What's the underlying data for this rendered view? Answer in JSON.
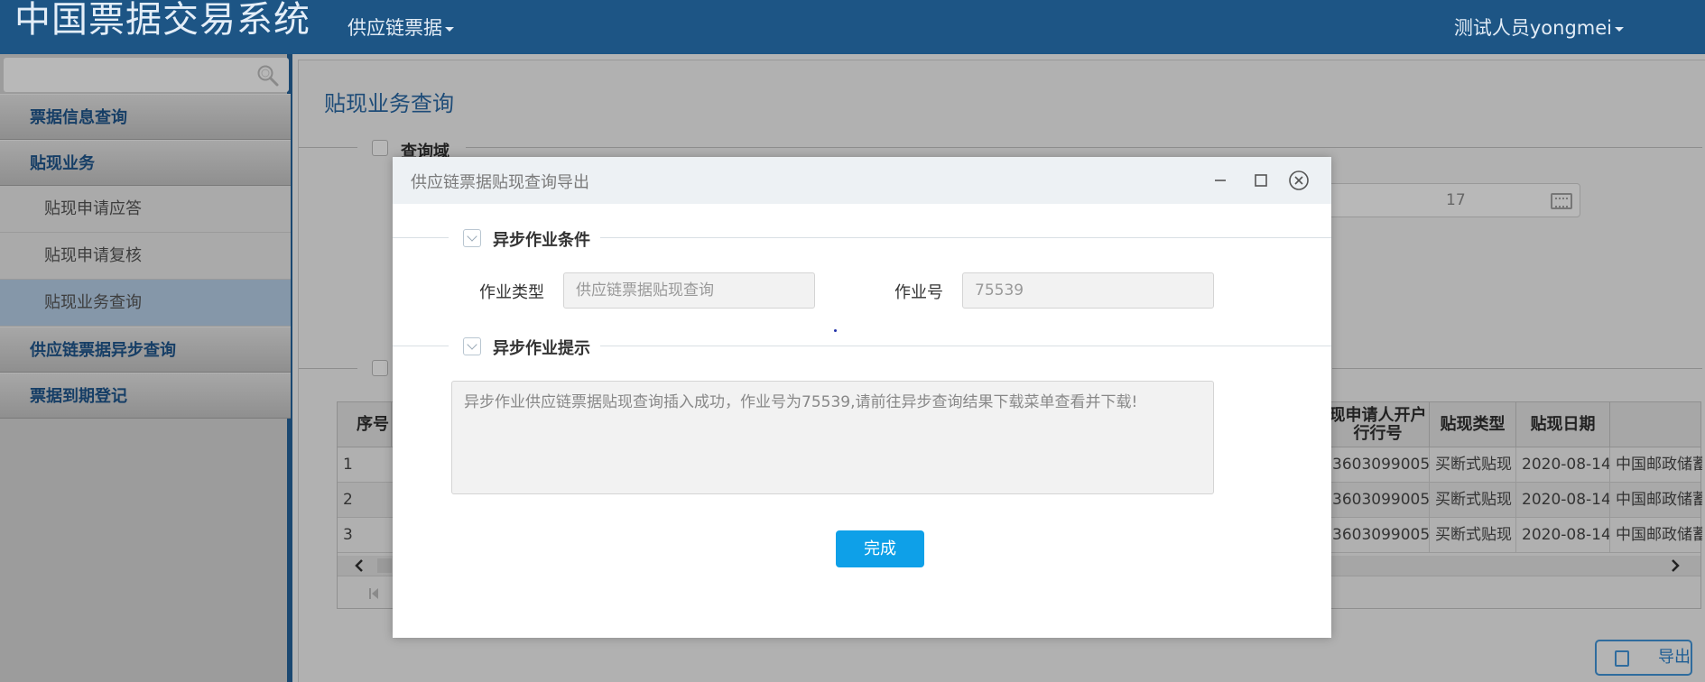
{
  "header": {
    "app_title": "中国票据交易系统",
    "menu_label": "供应链票据",
    "user_label": "测试人员yongmei"
  },
  "sidebar": {
    "search_icon": "search-icon",
    "items": [
      {
        "label": "票据信息查询",
        "type": "group"
      },
      {
        "label": "贴现业务",
        "type": "group"
      },
      {
        "label": "贴现申请应答",
        "type": "sub"
      },
      {
        "label": "贴现申请复核",
        "type": "sub"
      },
      {
        "label": "贴现业务查询",
        "type": "sub",
        "active": true
      },
      {
        "label": "供应链票据异步查询",
        "type": "group"
      },
      {
        "label": "票据到期登记",
        "type": "group"
      }
    ]
  },
  "main": {
    "title": "贴现业务查询",
    "query_section_label": "查询域",
    "date_value": "17",
    "grid": {
      "headers": {
        "seq": "序号",
        "acct_bank": "现申请人开户行行号",
        "disc_type": "贴现类型",
        "disc_date": "贴现日期"
      },
      "rows": [
        {
          "seq": "1",
          "acct_bank": "3603099005",
          "disc_type": "买断式贴现",
          "disc_date": "2020-08-14",
          "bank": "中国邮政储蓄"
        },
        {
          "seq": "2",
          "acct_bank": "3603099005",
          "disc_type": "买断式贴现",
          "disc_date": "2020-08-14",
          "bank": "中国邮政储蓄"
        },
        {
          "seq": "3",
          "acct_bank": "3603099005",
          "disc_type": "买断式贴现",
          "disc_date": "2020-08-14",
          "bank": "中国邮政储蓄"
        }
      ]
    },
    "export_label": "导出"
  },
  "modal": {
    "title": "供应链票据贴现查询导出",
    "section1_label": "异步作业条件",
    "job_type_label": "作业类型",
    "job_type_value": "供应链票据贴现查询",
    "job_no_label": "作业号",
    "job_no_value": "75539",
    "section2_label": "异步作业提示",
    "message": "异步作业供应链票据贴现查询插入成功，作业号为75539,请前往异步查询结果下载菜单查看并下载!",
    "done_label": "完成"
  },
  "colors": {
    "header_bg": "#1d5585",
    "primary_button": "#0ea0e8",
    "overlay_dim": "#b4b4b4"
  }
}
